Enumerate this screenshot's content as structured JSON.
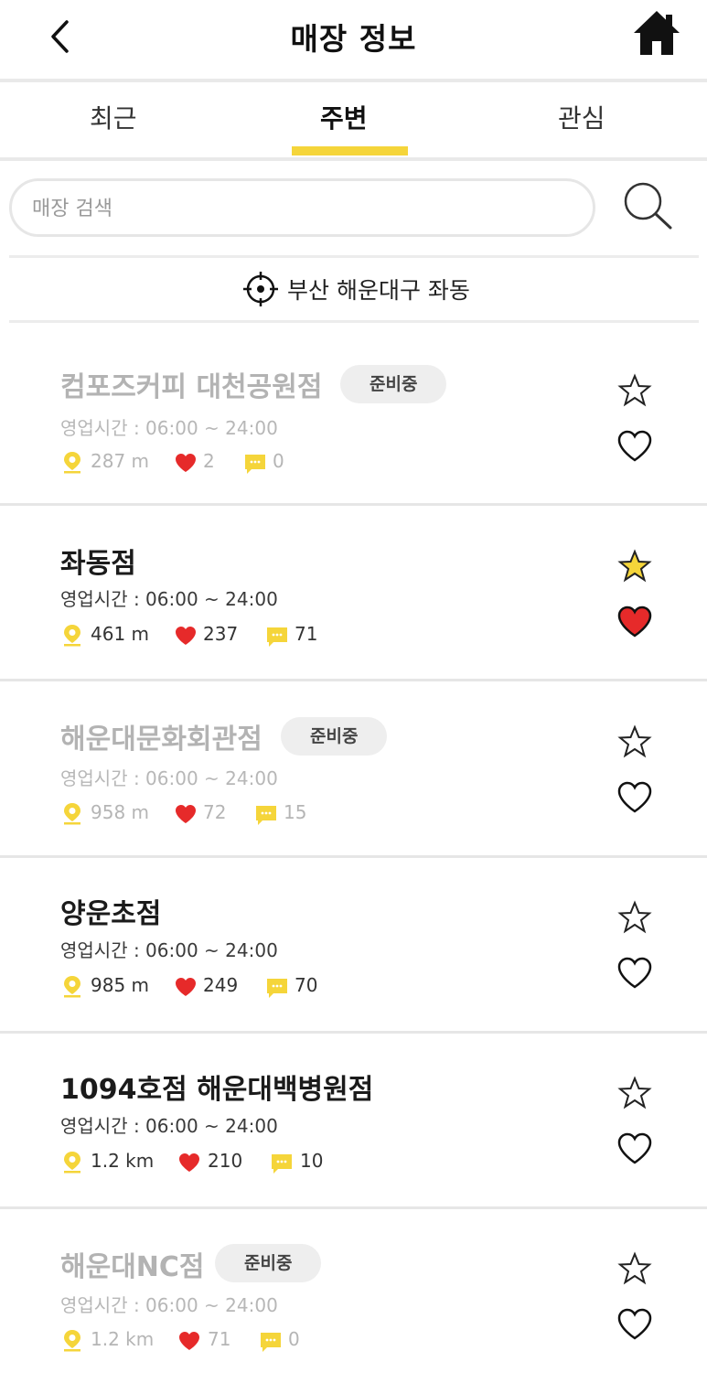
{
  "header": {
    "title": "매장 정보"
  },
  "tabs": [
    {
      "label": "최근",
      "active": false
    },
    {
      "label": "주변",
      "active": true
    },
    {
      "label": "관심",
      "active": false
    }
  ],
  "search": {
    "placeholder": "매장 검색",
    "value": ""
  },
  "location": {
    "label": "부산 해운대구 좌동"
  },
  "colors": {
    "accent_yellow": "#f5d53a",
    "heart_red": "#e62a2a",
    "inactive_text": "#b3b3b3"
  },
  "stores": [
    {
      "name": "컴포즈커피 대천공원점",
      "badge": "준비중",
      "hours": "영업시간 : 06:00 ~ 24:00",
      "distance": "287 m",
      "likes": "2",
      "comments": "0",
      "starred": false,
      "hearted": false
    },
    {
      "name": "좌동점",
      "badge": "",
      "hours": "영업시간 : 06:00 ~ 24:00",
      "distance": "461 m",
      "likes": "237",
      "comments": "71",
      "starred": true,
      "hearted": true
    },
    {
      "name": "해운대문화회관점",
      "badge": "준비중",
      "hours": "영업시간 : 06:00 ~ 24:00",
      "distance": "958 m",
      "likes": "72",
      "comments": "15",
      "starred": false,
      "hearted": false
    },
    {
      "name": "양운초점",
      "badge": "",
      "hours": "영업시간 : 06:00 ~ 24:00",
      "distance": "985 m",
      "likes": "249",
      "comments": "70",
      "starred": false,
      "hearted": false
    },
    {
      "name": "1094호점 해운대백병원점",
      "badge": "",
      "hours": "영업시간 : 06:00 ~ 24:00",
      "distance": "1.2 km",
      "likes": "210",
      "comments": "10",
      "starred": false,
      "hearted": false
    },
    {
      "name": "해운대NC점",
      "badge": "준비중",
      "hours": "영업시간 : 06:00 ~ 24:00",
      "distance": "1.2 km",
      "likes": "71",
      "comments": "0",
      "starred": false,
      "hearted": false
    }
  ]
}
